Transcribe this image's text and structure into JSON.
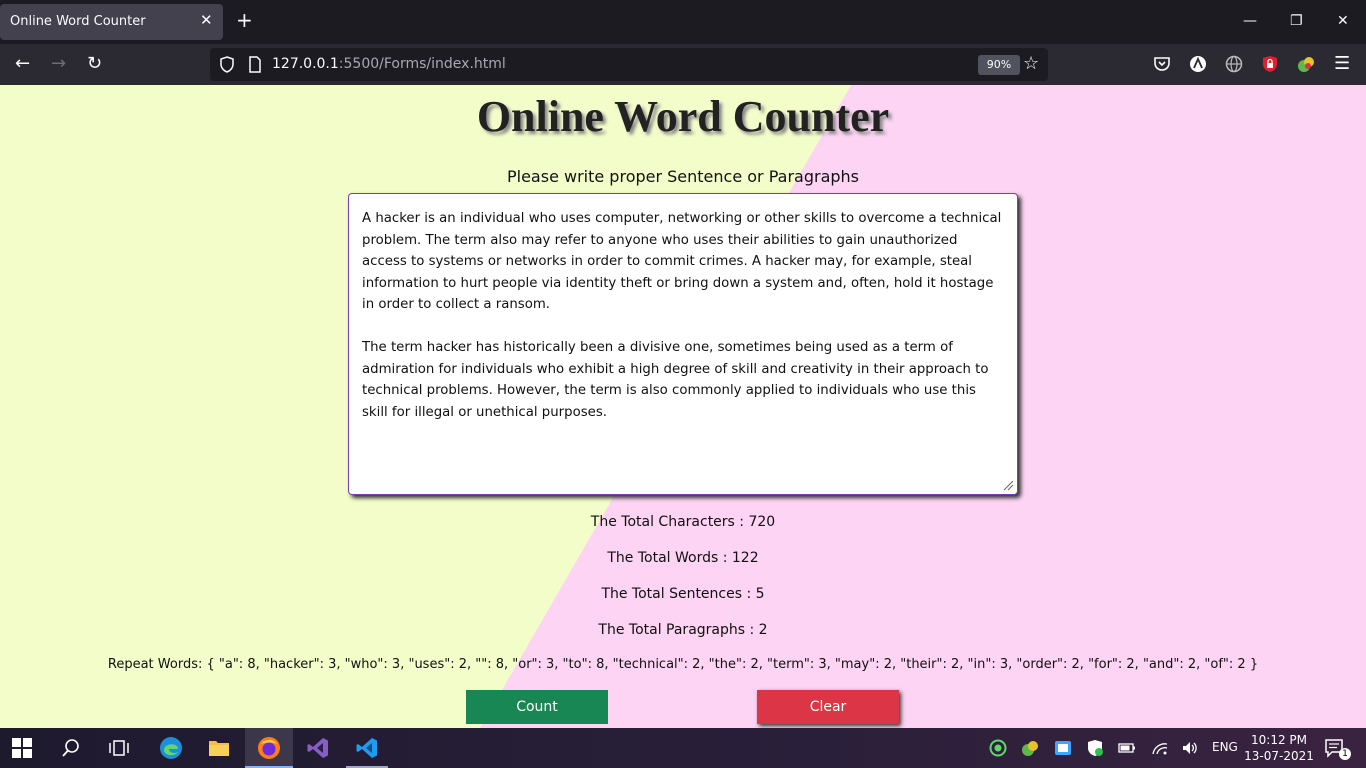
{
  "browser": {
    "tab_title": "Online Word Counter",
    "tab_close": "✕",
    "new_tab": "+",
    "url_host": "127.0.0.1",
    "url_rest": ":5500/Forms/index.html",
    "zoom": "90%"
  },
  "page": {
    "title": "Online Word Counter",
    "subtitle": "Please write proper Sentence or Paragraphs",
    "textarea_value": "A hacker is an individual who uses computer, networking or other skills to overcome a technical problem. The term also may refer to anyone who uses their abilities to gain unauthorized access to systems or networks in order to commit crimes. A hacker may, for example, steal information to hurt people via identity theft or bring down a system and, often, hold it hostage in order to collect a ransom.\n\nThe term hacker has historically been a divisive one, sometimes being used as a term of admiration for individuals who exhibit a high degree of skill and creativity in their approach to technical problems. However, the term is also commonly applied to individuals who use this skill for illegal or unethical purposes.",
    "stats": {
      "characters": "The Total Characters : 720",
      "words": "The Total Words : 122",
      "sentences": "The Total Sentences : 5",
      "paragraphs": "The Total Paragraphs : 2"
    },
    "repeat_words": "Repeat Words: { \"a\": 8, \"hacker\": 3, \"who\": 3, \"uses\": 2, \"\": 8, \"or\": 3, \"to\": 8, \"technical\": 2, \"the\": 2, \"term\": 3, \"may\": 2, \"their\": 2, \"in\": 3, \"order\": 2, \"for\": 2, \"and\": 2, \"of\": 2 }",
    "count_button": "Count",
    "clear_button": "Clear",
    "count_color": "#198754",
    "clear_color": "#dc3545"
  },
  "taskbar": {
    "time": "10:12 PM",
    "date": "13-07-2021",
    "language": "ENG",
    "notifications": "1"
  }
}
